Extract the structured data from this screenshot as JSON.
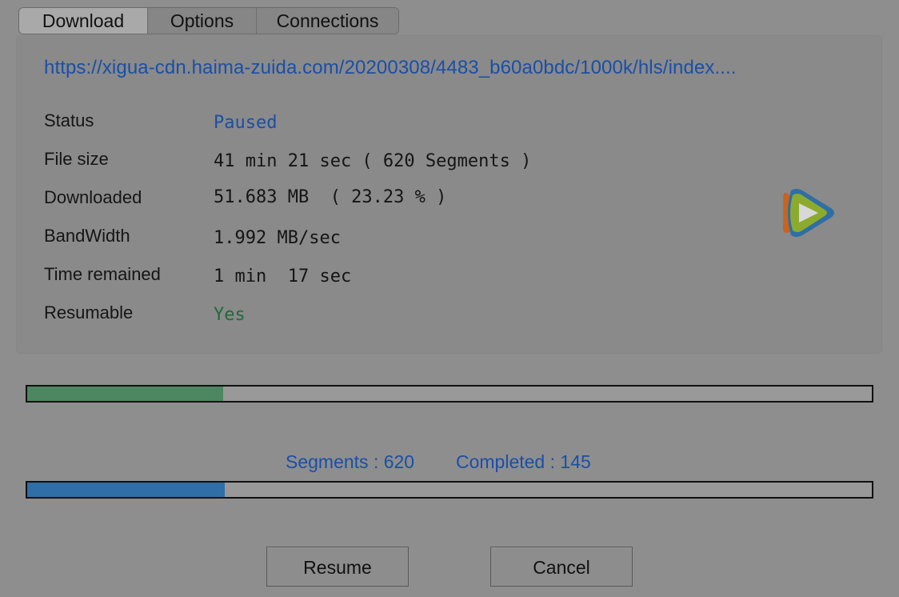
{
  "tabs": [
    {
      "label": "Download",
      "active": true
    },
    {
      "label": "Options",
      "active": false
    },
    {
      "label": "Connections",
      "active": false
    }
  ],
  "download": {
    "url": "https://xigua-cdn.haima-zuida.com/20200308/4483_b60a0bdc/1000k/hls/index....",
    "fields": {
      "status": {
        "label": "Status",
        "value": "Paused"
      },
      "file_size": {
        "label": "File size",
        "value": "41 min 21 sec ( 620 Segments )"
      },
      "downloaded": {
        "label": "Downloaded",
        "value": "51.683 MB  ( 23.23 % )"
      },
      "bandwidth": {
        "label": "BandWidth",
        "value": "1.992 MB/sec"
      },
      "time_remained": {
        "label": "Time remained",
        "value": "1 min  17 sec"
      },
      "resumable": {
        "label": "Resumable",
        "value": "Yes"
      }
    },
    "logo_icon": "tencent-video-logo-icon"
  },
  "progress": {
    "download_progress": 0.2323,
    "segments_progress": 0.2339,
    "download_color": "#4c8762",
    "segments_color": "#2f6ea6"
  },
  "segments": {
    "segments_text": "Segments : 620",
    "completed_text": "Completed : 145"
  },
  "buttons": {
    "resume_label": "Resume",
    "cancel_label": "Cancel"
  },
  "colors": {
    "link": "#1a4fa8",
    "status_paused": "#1a4fa8",
    "resumable_yes": "#1f6b3a"
  }
}
